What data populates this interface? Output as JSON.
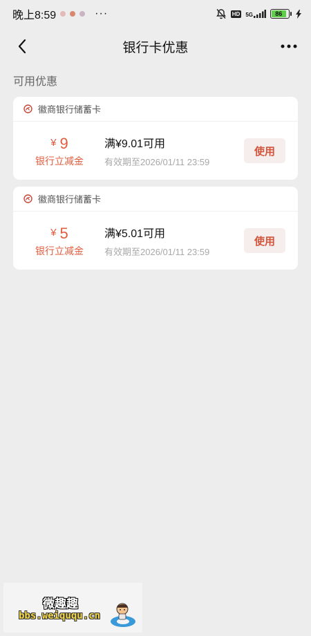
{
  "status": {
    "time": "晚上8:59",
    "more": "···",
    "network": "5G",
    "battery": "86"
  },
  "nav": {
    "title": "银行卡优惠",
    "more": "•••"
  },
  "section": {
    "label": "可用优惠"
  },
  "coupons": [
    {
      "bank": "徽商银行储蓄卡",
      "currency": "¥",
      "amount": "9",
      "type": "银行立减金",
      "condition": "满¥9.01可用",
      "expiry": "有效期至2026/01/11 23:59",
      "action": "使用"
    },
    {
      "bank": "徽商银行储蓄卡",
      "currency": "¥",
      "amount": "5",
      "type": "银行立减金",
      "condition": "满¥5.01可用",
      "expiry": "有效期至2026/01/11 23:59",
      "action": "使用"
    }
  ],
  "watermark": {
    "title": "微趣趣",
    "url": "bbs.weiququ.cn"
  },
  "colors": {
    "accent": "#e05d3f",
    "button_bg": "#f5eeec",
    "page_bg": "#ededed"
  }
}
